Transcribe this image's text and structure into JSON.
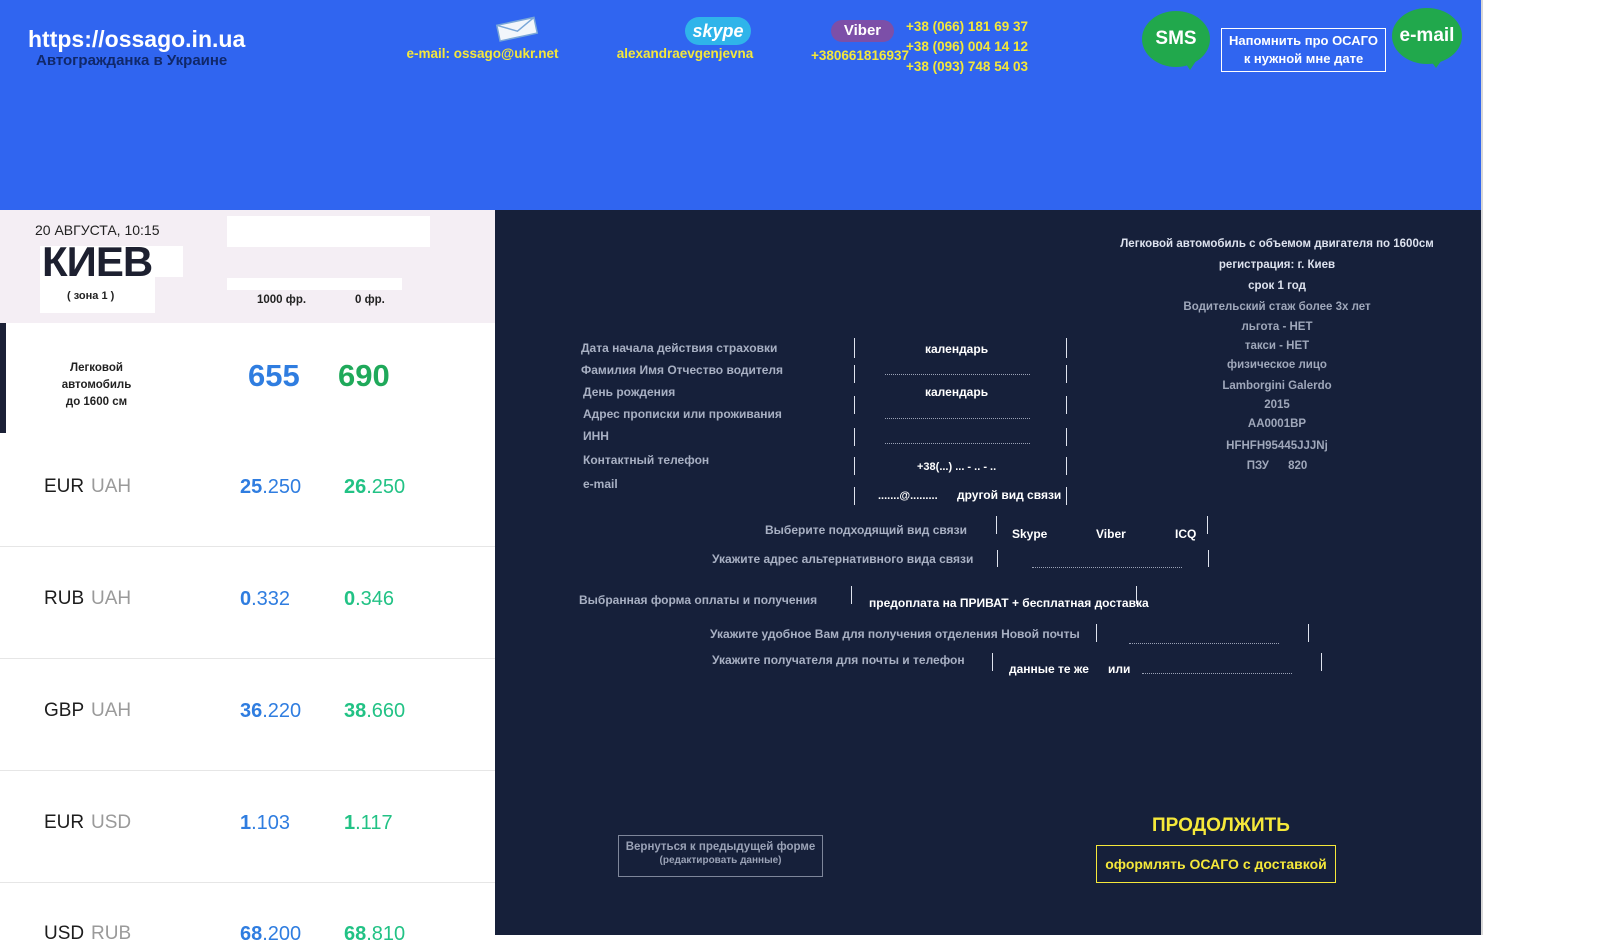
{
  "header": {
    "site_url": "https://ossago.in.ua",
    "tagline": "Автогражданка в Украине",
    "email_contact": "e-mail: ossago@ukr.net",
    "skype_logo": "skype",
    "skype_contact": "alexandraevgenjevna",
    "viber_logo": "Viber",
    "viber_contact": "+380661816937",
    "phones": [
      "+38 (066) 181 69 37",
      "+38 (096) 004 14 12",
      "+38 (093) 748 54 03"
    ],
    "sms_button": "SMS",
    "remind_button_line1": "Напомнить про ОСАГО",
    "remind_button_line2": "к нужной мне дате",
    "email_button": "e-mail"
  },
  "left": {
    "date_time": "20 АВГУСТА, 10:15",
    "city": "КИЕВ",
    "zone": "( зона 1 )",
    "col1_header": "1000 фр.",
    "col2_header": "0 фр.",
    "car_label_line1": "Легковой автомобиль",
    "car_label_line2": "до 1600 см",
    "price_franchise": "655",
    "price_no_franchise": "690",
    "rates": [
      {
        "c1": "EUR",
        "c2": "UAH",
        "b1": "25",
        "r1": ".250",
        "b2": "26",
        "r2": ".250"
      },
      {
        "c1": "RUB",
        "c2": "UAH",
        "b1": "0",
        "r1": ".332",
        "b2": "0",
        "r2": ".346"
      },
      {
        "c1": "GBP",
        "c2": "UAH",
        "b1": "36",
        "r1": ".220",
        "b2": "38",
        "r2": ".660"
      },
      {
        "c1": "EUR",
        "c2": "USD",
        "b1": "1",
        "r1": ".103",
        "b2": "1",
        "r2": ".117"
      },
      {
        "c1": "USD",
        "c2": "RUB",
        "b1": "68",
        "r1": ".200",
        "b2": "68",
        "r2": ".810"
      }
    ]
  },
  "form": {
    "start_date_label": "Дата начала действия страховки",
    "start_date_value": "календарь",
    "fio_label": "Фамилия Имя Отчество водителя",
    "birthday_label": "День рождения",
    "birthday_value": "календарь",
    "address_label": "Адрес прописки или проживания",
    "inn_label": "ИНН",
    "phone_label": "Контактный телефон",
    "phone_value": "+38(...) ... - .. - ..",
    "email_label": "e-mail",
    "email_value": ".......@.........",
    "other_contact": "другой вид связи",
    "contact_type_label": "Выберите подходящий вид связи",
    "contact_types": [
      "Skype",
      "Viber",
      "ICQ"
    ],
    "alt_address_label": "Укажите адрес альтернативного вида связи",
    "payment_label": "Выбранная форма оплаты и получения",
    "payment_value": "предоплата на ПРИВАТ + бесплатная доставка",
    "np_label": "Укажите  удобное Вам для получения отделения Новой почты",
    "recipient_label": "Укажите получателя для почты и телефон",
    "recipient_same": "данные те же",
    "recipient_or": "или",
    "back_button_line1": "Вернуться к предыдущей форме",
    "back_button_line2": "(редактировать данные)",
    "continue_title": "ПРОДОЛЖИТЬ",
    "continue_button": "оформлять ОСАГО с доставкой"
  },
  "summary": [
    "Легковой автомобиль с объемом двигателя по 1600см",
    "регистрация: г. Киев",
    "срок 1 год",
    "Водительский стаж более 3х лет",
    "льгота - НЕТ",
    "такси - НЕТ",
    "физическое лицо",
    "Lamborgini Galerdo",
    "2015",
    "АА0001ВР",
    "HFHFH95445JJJNj",
    "ПЗУ      820"
  ]
}
